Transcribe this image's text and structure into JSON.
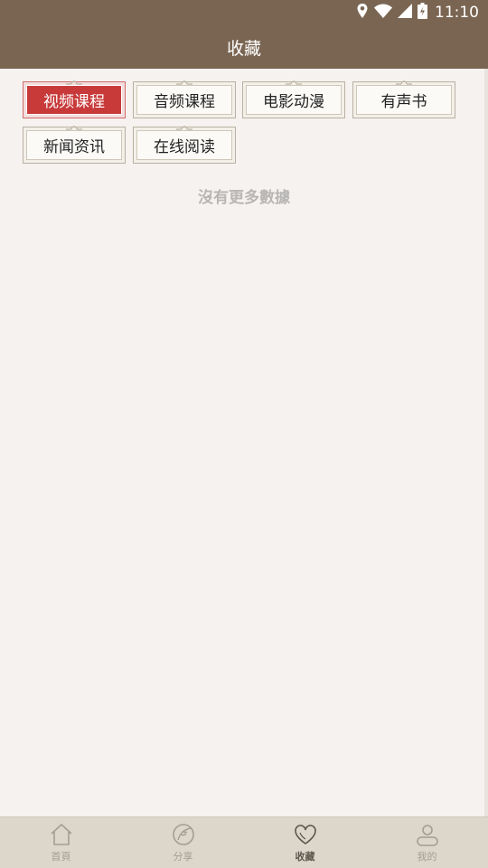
{
  "status_bar": {
    "time": "11:10",
    "icons": [
      "location-icon",
      "wifi-icon",
      "signal-icon",
      "battery-charging-icon"
    ]
  },
  "header": {
    "title": "收藏"
  },
  "tabs": [
    {
      "label": "视频课程",
      "active": true
    },
    {
      "label": "音频课程",
      "active": false
    },
    {
      "label": "电影动漫",
      "active": false
    },
    {
      "label": "有声书",
      "active": false
    },
    {
      "label": "新闻资讯",
      "active": false
    },
    {
      "label": "在线阅读",
      "active": false
    }
  ],
  "empty_message": "沒有更多數據",
  "bottom_nav": [
    {
      "label": "首頁",
      "icon": "home-icon",
      "active": false
    },
    {
      "label": "分享",
      "icon": "share-leaf-icon",
      "active": false
    },
    {
      "label": "收藏",
      "icon": "heart-icon",
      "active": true
    },
    {
      "label": "我的",
      "icon": "profile-icon",
      "active": false
    }
  ],
  "colors": {
    "header": "#7a6552",
    "background": "#f5f2f0",
    "active_tab": "#c83a3a",
    "bottom_bar": "#ddd7cb"
  }
}
